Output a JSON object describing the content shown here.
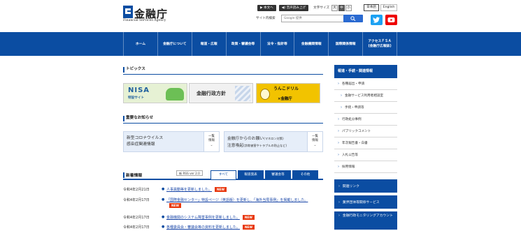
{
  "header": {
    "logo_jp": "金融庁",
    "logo_en": "Financial Services Agency",
    "tools": {
      "honbun": "▶ 本文へ",
      "read_aloud": "◀) 音声読み上げ",
      "font_size_label": "文字サイズ",
      "font_sizes": [
        "大",
        "中",
        "小"
      ]
    },
    "lang_ja": "日本語",
    "lang_en": "English",
    "search": {
      "label": "サイト内検索",
      "placeholder": "Google 提供"
    }
  },
  "nav": [
    {
      "label": "ホーム"
    },
    {
      "label": "金融庁について"
    },
    {
      "label": "報道・広報"
    },
    {
      "label": "政策・審議会等"
    },
    {
      "label": "法令・指針等"
    },
    {
      "label": "金融機関情報"
    },
    {
      "label": "国際関係情報"
    },
    {
      "label": "アクセスＦＳＡ",
      "sub": "(金融庁広報誌)"
    }
  ],
  "topics": {
    "title": "トピックス",
    "banners": [
      {
        "title": "NISA",
        "sub": "特設サイト"
      },
      {
        "title": "金融行政方針"
      },
      {
        "title": "うんこドリル",
        "sub": "×金融庁"
      }
    ]
  },
  "important": {
    "title": "重要なお知らせ",
    "items": [
      {
        "line1": "新型コロナウイルス",
        "line2": "感染症関連情報",
        "more": [
          "一覧",
          "情報",
          "⌄"
        ]
      },
      {
        "line1": "金融庁からのお願い",
        "line1_small": "(マネロン対策)",
        "line2": "注意喚起",
        "line2_small": "(詐欺被害やトラブルの防止など)",
        "more": [
          "一覧",
          "情報",
          "⌄"
        ]
      }
    ]
  },
  "news": {
    "title": "新着情報",
    "rss": "新 RSS ver 2.0",
    "tabs": [
      "すべて",
      "報道発表",
      "審議会等",
      "その他"
    ],
    "new_label": "NEW",
    "items": [
      {
        "date": "令和4年2月21日",
        "text": "人事異動等を更新しました。",
        "new": true
      },
      {
        "date": "令和4年2月17日",
        "text": "「国際金融センター」特設ページ（英語版）を更新し、「海外当局事例」を掲載しました。",
        "new": true
      },
      {
        "date": "令和4年2月17日",
        "text": "金融機関のシステム障害事例を更新しました。",
        "new": true
      },
      {
        "date": "令和4年2月17日",
        "text": "各種委員会・審議会等の資料を更新しました。",
        "new": true
      }
    ]
  },
  "sidebar": {
    "head": "報道・手続・関連情報",
    "items": [
      {
        "label": "各種届出・申請",
        "sub": false
      },
      {
        "label": "金融サービス利用者相談室",
        "sub": true
      },
      {
        "label": "手続・申請等",
        "sub": true
      },
      {
        "label": "行政処分事例",
        "sub": false
      },
      {
        "label": "パブリックコメント",
        "sub": false
      },
      {
        "label": "年次報告書・白書",
        "sub": false
      },
      {
        "label": "入札公告等",
        "sub": false
      },
      {
        "label": "採用情報",
        "sub": false
      }
    ],
    "links": [
      {
        "label": "関連リンク"
      },
      {
        "label": "業界団体等関係サービス"
      },
      {
        "label": "金融行政モニタリングアカウント"
      }
    ]
  },
  "colors": {
    "brand_blue": "#0b4da2",
    "new_badge": "#e8380d",
    "twitter": "#1da1f2",
    "youtube": "#ee0000"
  }
}
